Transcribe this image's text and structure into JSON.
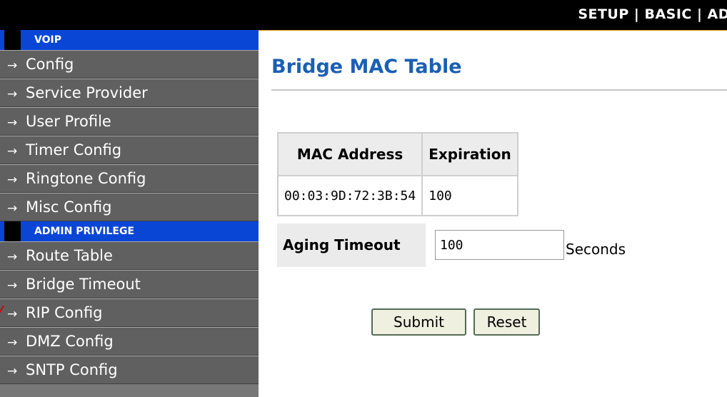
{
  "topnav": {
    "text": "SETUP | BASIC | AD"
  },
  "sidebar": {
    "sections": [
      {
        "title": "VOIP",
        "items": [
          "Config",
          "Service Provider",
          "User Profile",
          "Timer Config",
          "Ringtone Config",
          "Misc Config"
        ]
      },
      {
        "title": "ADMIN PRIVILEGE",
        "items": [
          "Route Table",
          "Bridge Timeout",
          "RIP Config",
          "DMZ Config",
          "SNTP Config"
        ]
      }
    ],
    "arrow_glyph": "→"
  },
  "main": {
    "title": "Bridge MAC Table",
    "table": {
      "headers": [
        "MAC Address",
        "Expiration"
      ],
      "rows": [
        [
          "00:03:9D:72:3B:54",
          "100"
        ]
      ]
    },
    "aging": {
      "label": "Aging Timeout",
      "value": "100",
      "unit": "Seconds"
    },
    "buttons": {
      "submit": "Submit",
      "reset": "Reset"
    }
  },
  "colors": {
    "accent": "#1a5fb4",
    "section_blue": "#0a46d6",
    "sidebar_gray": "#606060"
  }
}
